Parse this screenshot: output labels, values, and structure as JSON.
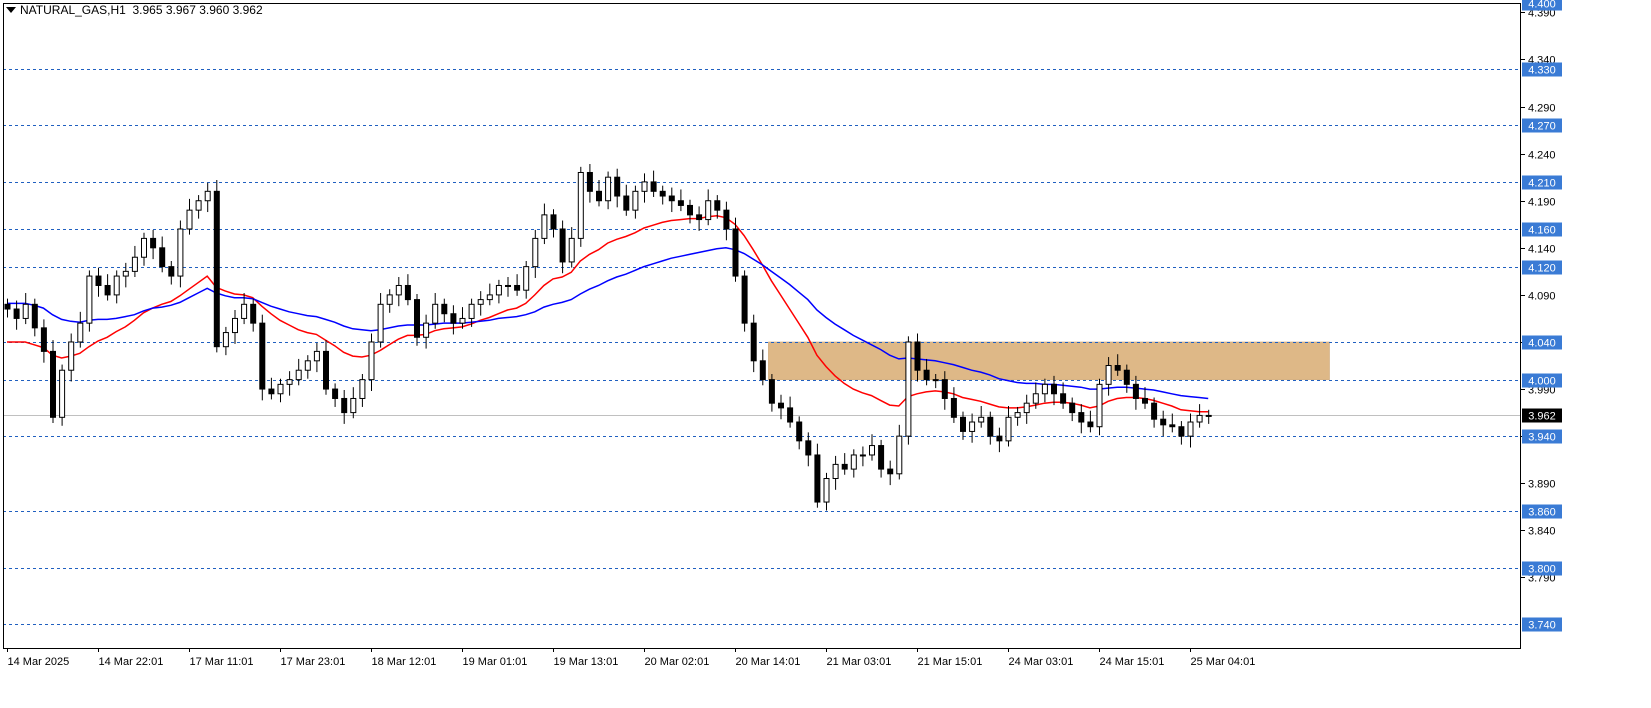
{
  "header": {
    "symbol": "NATURAL_GAS,H1",
    "open": "3.965",
    "high": "3.967",
    "low": "3.960",
    "close": "3.962"
  },
  "colors": {
    "background": "#ffffff",
    "bull_candle": "#ffffff",
    "bear_candle": "#000000",
    "ma_fast": "#ff0000",
    "ma_slow": "#0000ff",
    "level_line": "#2060c0",
    "level_label_bg": "#3a7bd5",
    "zone": "#deb887",
    "current_label_bg": "#000000"
  },
  "chart_data": {
    "type": "candlestick",
    "ylim": [
      3.715,
      4.4
    ],
    "price_ticks": [
      "4.390",
      "4.340",
      "4.290",
      "4.240",
      "4.190",
      "4.140",
      "4.090",
      "4.040",
      "3.990",
      "3.940",
      "3.890",
      "3.840",
      "3.790"
    ],
    "level_lines": [
      "4.400",
      "4.330",
      "4.270",
      "4.210",
      "4.160",
      "4.120",
      "4.040",
      "4.000",
      "3.940",
      "3.860",
      "3.800",
      "3.740"
    ],
    "current_price": "3.962",
    "zone": {
      "from_index": 84,
      "to_index": 145,
      "low": 4.0,
      "high": 4.04
    },
    "x_labels": [
      {
        "index": 0,
        "label": "14 Mar 2025"
      },
      {
        "index": 10,
        "label": "14 Mar 22:01"
      },
      {
        "index": 20,
        "label": "17 Mar 11:01"
      },
      {
        "index": 30,
        "label": "17 Mar 23:01"
      },
      {
        "index": 40,
        "label": "18 Mar 12:01"
      },
      {
        "index": 50,
        "label": "19 Mar 01:01"
      },
      {
        "index": 60,
        "label": "19 Mar 13:01"
      },
      {
        "index": 70,
        "label": "20 Mar 02:01"
      },
      {
        "index": 80,
        "label": "20 Mar 14:01"
      },
      {
        "index": 90,
        "label": "21 Mar 03:01"
      },
      {
        "index": 100,
        "label": "21 Mar 15:01"
      },
      {
        "index": 110,
        "label": "24 Mar 03:01"
      },
      {
        "index": 120,
        "label": "24 Mar 15:01"
      },
      {
        "index": 130,
        "label": "25 Mar 04:01"
      }
    ],
    "closes": [
      4.075,
      4.065,
      4.08,
      4.055,
      4.03,
      3.96,
      4.01,
      4.04,
      4.06,
      4.11,
      4.1,
      4.09,
      4.11,
      4.115,
      4.13,
      4.15,
      4.14,
      4.12,
      4.11,
      4.16,
      4.18,
      4.19,
      4.2,
      4.035,
      4.05,
      4.065,
      4.08,
      4.06,
      3.99,
      3.985,
      3.995,
      4.0,
      4.01,
      4.02,
      4.03,
      3.99,
      3.98,
      3.965,
      3.98,
      4.0,
      4.04,
      4.08,
      4.09,
      4.1,
      4.085,
      4.045,
      4.06,
      4.08,
      4.07,
      4.06,
      4.065,
      4.08,
      4.085,
      4.09,
      4.1,
      4.1,
      4.095,
      4.12,
      4.15,
      4.175,
      4.16,
      4.125,
      4.15,
      4.22,
      4.2,
      4.19,
      4.215,
      4.195,
      4.18,
      4.2,
      4.21,
      4.2,
      4.195,
      4.19,
      4.185,
      4.175,
      4.17,
      4.19,
      4.18,
      4.16,
      4.11,
      4.06,
      4.02,
      4.0,
      3.975,
      3.97,
      3.955,
      3.935,
      3.92,
      3.87,
      3.895,
      3.91,
      3.905,
      3.92,
      3.92,
      3.93,
      3.905,
      3.9,
      3.94,
      4.04,
      4.01,
      4.0,
      4.0,
      3.98,
      3.96,
      3.945,
      3.955,
      3.96,
      3.94,
      3.935,
      3.96,
      3.965,
      3.975,
      3.985,
      3.995,
      3.985,
      3.975,
      3.965,
      3.955,
      3.95,
      3.995,
      4.015,
      4.01,
      3.995,
      3.98,
      3.975,
      3.958,
      3.952,
      3.95,
      3.94,
      3.955,
      3.962,
      3.962
    ],
    "series": [
      {
        "values": [
          4.04,
          4.04,
          4.04,
          4.037,
          4.034,
          4.026,
          4.023,
          4.025,
          4.028,
          4.035,
          4.041,
          4.045,
          4.051,
          4.056,
          4.063,
          4.071,
          4.076,
          4.08,
          4.083,
          4.089,
          4.096,
          4.103,
          4.11,
          4.098,
          4.094,
          4.091,
          4.09,
          4.087,
          4.078,
          4.07,
          4.063,
          4.058,
          4.053,
          4.05,
          4.048,
          4.042,
          4.036,
          4.029,
          4.025,
          4.024,
          4.026,
          4.031,
          4.037,
          4.043,
          4.047,
          4.047,
          4.048,
          4.052,
          4.054,
          4.055,
          4.056,
          4.059,
          4.063,
          4.066,
          4.07,
          4.074,
          4.076,
          4.081,
          4.09,
          4.1,
          4.107,
          4.109,
          4.114,
          4.126,
          4.133,
          4.138,
          4.145,
          4.149,
          4.152,
          4.156,
          4.161,
          4.164,
          4.167,
          4.169,
          4.17,
          4.171,
          4.171,
          4.173,
          4.174,
          4.172,
          4.165,
          4.153,
          4.138,
          4.122,
          4.105,
          4.09,
          4.075,
          4.06,
          4.045,
          4.026,
          4.014,
          4.004,
          3.996,
          3.99,
          3.986,
          3.983,
          3.978,
          3.973,
          3.972,
          3.982,
          3.985,
          3.987,
          3.988,
          3.987,
          3.985,
          3.981,
          3.979,
          3.977,
          3.974,
          3.971,
          3.97,
          3.97,
          3.971,
          3.973,
          3.975,
          3.976,
          3.976,
          3.975,
          3.973,
          3.97,
          3.972,
          3.977,
          3.98,
          3.981,
          3.981,
          3.98,
          3.978,
          3.975,
          3.972,
          3.968,
          3.967,
          3.966,
          3.966
        ]
      },
      {
        "values": [
          4.081,
          4.081,
          4.081,
          4.079,
          4.076,
          4.069,
          4.064,
          4.062,
          4.061,
          4.063,
          4.064,
          4.064,
          4.065,
          4.067,
          4.069,
          4.073,
          4.076,
          4.077,
          4.079,
          4.082,
          4.087,
          4.092,
          4.097,
          4.092,
          4.089,
          4.087,
          4.087,
          4.086,
          4.082,
          4.078,
          4.075,
          4.072,
          4.07,
          4.068,
          4.067,
          4.064,
          4.061,
          4.057,
          4.054,
          4.053,
          4.052,
          4.053,
          4.055,
          4.057,
          4.058,
          4.058,
          4.058,
          4.059,
          4.06,
          4.06,
          4.06,
          4.061,
          4.062,
          4.063,
          4.065,
          4.066,
          4.067,
          4.069,
          4.072,
          4.077,
          4.08,
          4.082,
          4.085,
          4.091,
          4.096,
          4.1,
          4.105,
          4.109,
          4.112,
          4.116,
          4.12,
          4.123,
          4.126,
          4.129,
          4.131,
          4.133,
          4.135,
          4.137,
          4.139,
          4.14,
          4.138,
          4.134,
          4.128,
          4.122,
          4.115,
          4.108,
          4.101,
          4.093,
          4.085,
          4.074,
          4.066,
          4.059,
          4.053,
          4.047,
          4.042,
          4.037,
          4.032,
          4.026,
          4.022,
          4.023,
          4.022,
          4.021,
          4.02,
          4.018,
          4.016,
          4.013,
          4.01,
          4.008,
          4.005,
          4.001,
          3.999,
          3.997,
          3.996,
          3.996,
          3.995,
          3.995,
          3.994,
          3.993,
          3.992,
          3.99,
          3.99,
          3.991,
          3.992,
          3.992,
          3.991,
          3.99,
          3.989,
          3.987,
          3.985,
          3.983,
          3.982,
          3.981,
          3.98
        ]
      }
    ]
  }
}
